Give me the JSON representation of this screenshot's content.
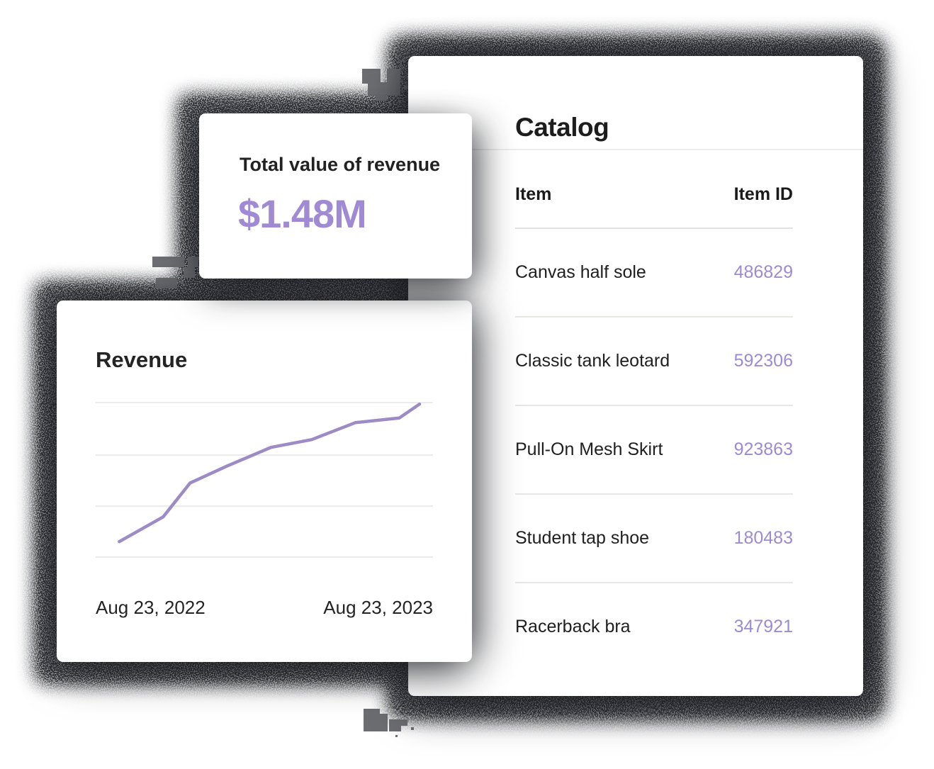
{
  "colors": {
    "accent_purple": "#a18ad4",
    "id_purple": "#9c8bd1",
    "line_purple": "#9c8bc4",
    "gridline": "#ebebeb",
    "shadow": "#1b1d21",
    "glyph_gray": "#6b6d71",
    "card_bg": "#ffffff",
    "text_dark": "#1d1d1d",
    "divider": "#e9e7e4"
  },
  "catalog": {
    "title": "Catalog",
    "table": {
      "headers": {
        "item": "Item",
        "id": "Item ID"
      },
      "rows": [
        {
          "item": "Canvas half sole",
          "id": "486829"
        },
        {
          "item": "Classic tank leotard",
          "id": "592306"
        },
        {
          "item": "Pull-On Mesh Skirt",
          "id": "923863"
        },
        {
          "item": "Student tap shoe",
          "id": "180483"
        },
        {
          "item": "Racerback bra",
          "id": "347921"
        }
      ]
    }
  },
  "total_revenue": {
    "label": "Total value of revenue",
    "value": "$1.48M"
  },
  "revenue_chart": {
    "title": "Revenue",
    "x_start": "Aug 23, 2022",
    "x_end": "Aug 23, 2023"
  },
  "chart_data": {
    "type": "line",
    "title": "Revenue",
    "xlabel": "",
    "ylabel": "",
    "x_axis": {
      "start_label": "Aug 23, 2022",
      "end_label": "Aug 23, 2023"
    },
    "y_axis_visible": false,
    "ylim": [
      0,
      100
    ],
    "grid": true,
    "grid_values": [
      0,
      33,
      66,
      100
    ],
    "legend": "none",
    "line_color": "#9c8bc4",
    "series": [
      {
        "name": "Revenue",
        "points": [
          {
            "x_frac": 0.07,
            "value": 10
          },
          {
            "x_frac": 0.2,
            "value": 26
          },
          {
            "x_frac": 0.28,
            "value": 48
          },
          {
            "x_frac": 0.39,
            "value": 59
          },
          {
            "x_frac": 0.52,
            "value": 71
          },
          {
            "x_frac": 0.64,
            "value": 76
          },
          {
            "x_frac": 0.77,
            "value": 87
          },
          {
            "x_frac": 0.9,
            "value": 90
          },
          {
            "x_frac": 0.96,
            "value": 99
          }
        ]
      }
    ]
  }
}
